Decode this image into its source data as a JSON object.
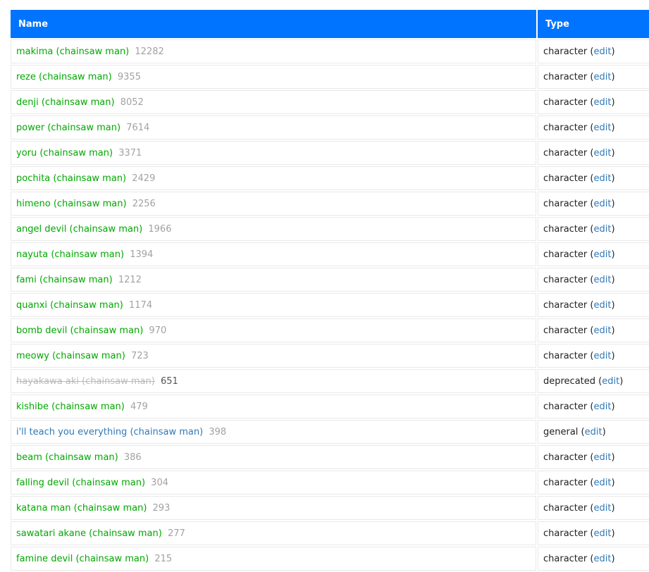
{
  "header": {
    "name_label": "Name",
    "type_label": "Type"
  },
  "colors": {
    "header_bg": "#0073ff",
    "character": "#00a800",
    "general": "#2e79b9",
    "deprecated": "#bbbbbb",
    "count": "#a2a2a2"
  },
  "edit_label": "edit",
  "rows": [
    {
      "name": "makima (chainsaw man)",
      "count": "12282",
      "type": "character"
    },
    {
      "name": "reze (chainsaw man)",
      "count": "9355",
      "type": "character"
    },
    {
      "name": "denji (chainsaw man)",
      "count": "8052",
      "type": "character"
    },
    {
      "name": "power (chainsaw man)",
      "count": "7614",
      "type": "character"
    },
    {
      "name": "yoru (chainsaw man)",
      "count": "3371",
      "type": "character"
    },
    {
      "name": "pochita (chainsaw man)",
      "count": "2429",
      "type": "character"
    },
    {
      "name": "himeno (chainsaw man)",
      "count": "2256",
      "type": "character"
    },
    {
      "name": "angel devil (chainsaw man)",
      "count": "1966",
      "type": "character"
    },
    {
      "name": "nayuta (chainsaw man)",
      "count": "1394",
      "type": "character"
    },
    {
      "name": "fami (chainsaw man)",
      "count": "1212",
      "type": "character"
    },
    {
      "name": "quanxi (chainsaw man)",
      "count": "1174",
      "type": "character"
    },
    {
      "name": "bomb devil (chainsaw man)",
      "count": "970",
      "type": "character"
    },
    {
      "name": "meowy (chainsaw man)",
      "count": "723",
      "type": "character"
    },
    {
      "name": "hayakawa aki (chainsaw man)",
      "count": "651",
      "type": "deprecated"
    },
    {
      "name": "kishibe (chainsaw man)",
      "count": "479",
      "type": "character"
    },
    {
      "name": "i'll teach you everything (chainsaw man)",
      "count": "398",
      "type": "general"
    },
    {
      "name": "beam (chainsaw man)",
      "count": "386",
      "type": "character"
    },
    {
      "name": "falling devil (chainsaw man)",
      "count": "304",
      "type": "character"
    },
    {
      "name": "katana man (chainsaw man)",
      "count": "293",
      "type": "character"
    },
    {
      "name": "sawatari akane (chainsaw man)",
      "count": "277",
      "type": "character"
    },
    {
      "name": "famine devil (chainsaw man)",
      "count": "215",
      "type": "character"
    }
  ]
}
